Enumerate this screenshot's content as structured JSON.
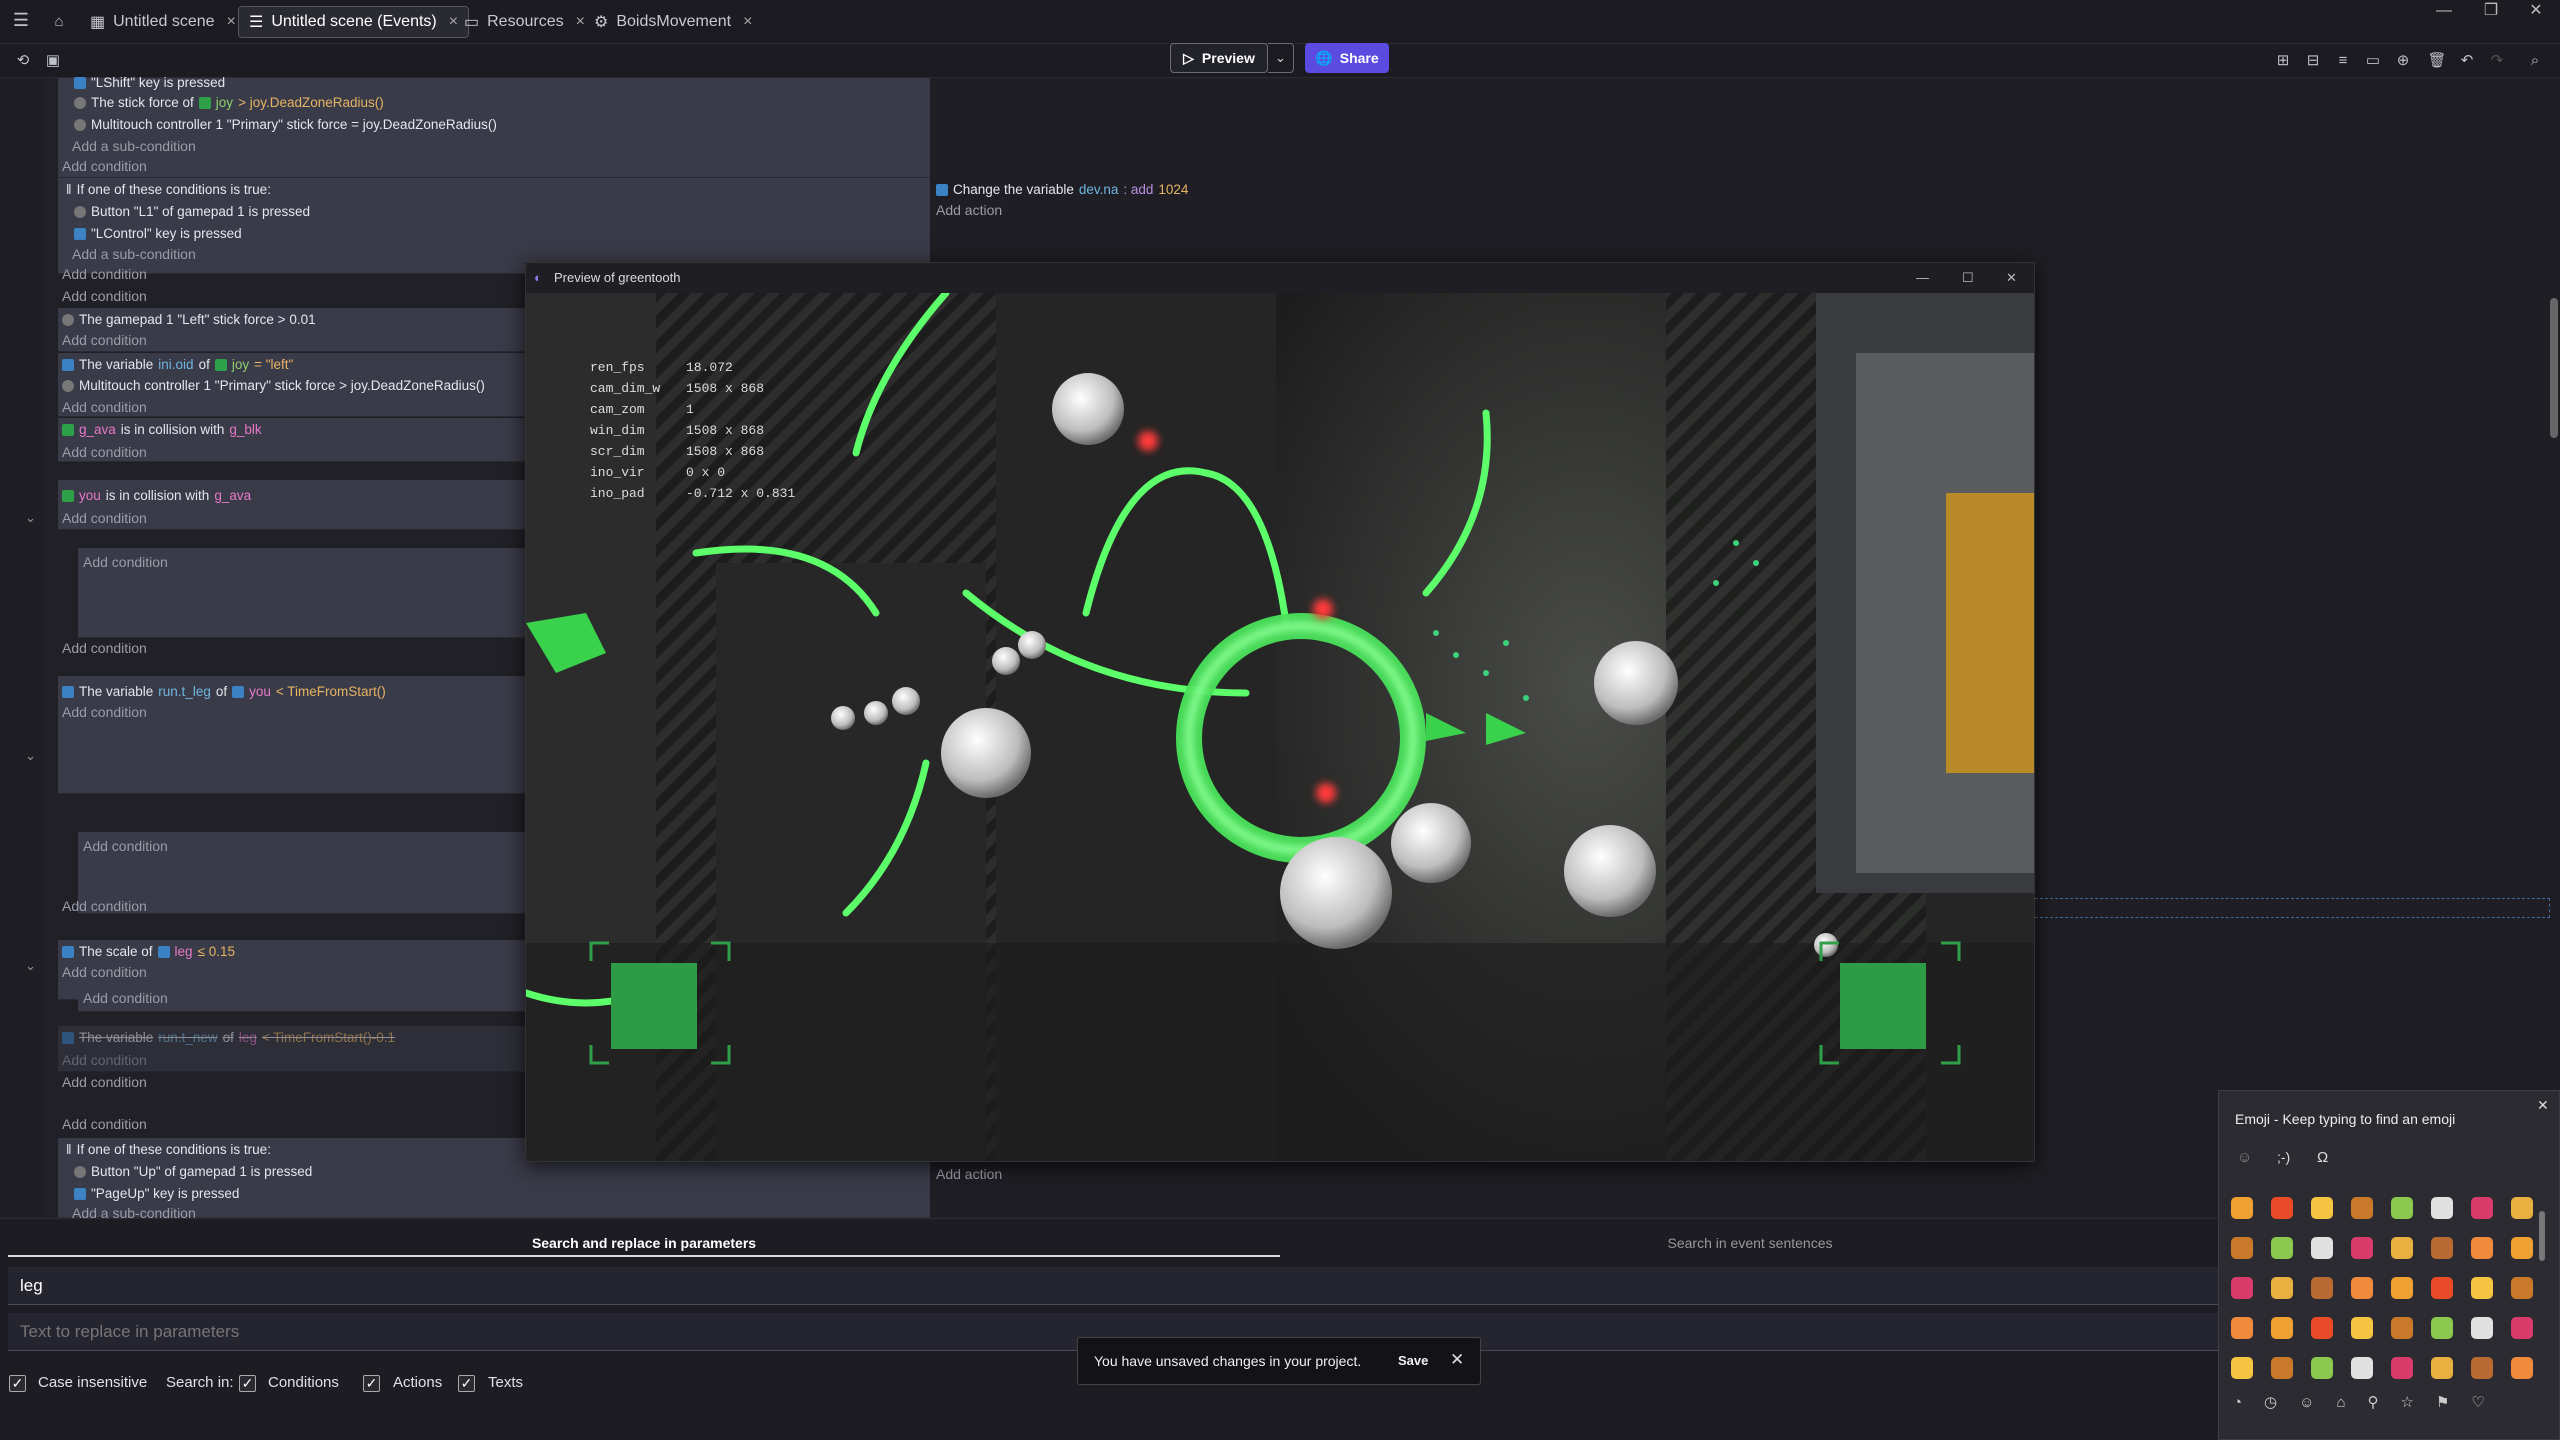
{
  "titlebar": {
    "tabs": [
      {
        "label": "Untitled scene",
        "icon": "scene-icon"
      },
      {
        "label": "Untitled scene (Events)",
        "icon": "events-icon"
      },
      {
        "label": "Resources",
        "icon": "resources-icon"
      },
      {
        "label": "BoidsMovement",
        "icon": "extension-icon"
      }
    ],
    "close_glyph": "×",
    "window_minimize": "—",
    "window_restore": "❐",
    "window_close": "✕"
  },
  "toolbar": {
    "preview_label": "Preview",
    "share_label": "Share"
  },
  "events": {
    "lines": [
      {
        "text": "\"LShift\" key is pressed"
      },
      {
        "text": "The stick force of",
        "obj": "joy",
        "rest": "> joy.DeadZoneRadius()"
      },
      {
        "text": "Multitouch controller 1 \"Primary\" stick force = joy.DeadZoneRadius()"
      },
      {
        "text": "Add a sub-condition"
      },
      {
        "text": "Add condition"
      },
      {
        "text": "If one of these conditions is true:"
      },
      {
        "text": "Button \"L1\" of gamepad 1 is pressed"
      },
      {
        "text": "\"LControl\" key is pressed"
      },
      {
        "text": "Add a sub-condition"
      },
      {
        "text": "Add condition"
      },
      {
        "text": "Add condition"
      },
      {
        "text": "The gamepad 1 \"Left\" stick force > 0.01"
      },
      {
        "text": "Add condition"
      },
      {
        "text": "The variable",
        "var": "ini.oid",
        "of": "of",
        "obj": "joy",
        "rest": "= \"left\""
      },
      {
        "text": "Multitouch controller 1 \"Primary\" stick force > joy.DeadZoneRadius()"
      },
      {
        "text": "Add condition"
      },
      {
        "text": "g_ava",
        "mid": "is in collision with",
        "obj": "g_blk"
      },
      {
        "text": "Add condition"
      },
      {
        "text": "you",
        "mid": "is in collision with",
        "obj": "g_ava"
      },
      {
        "text": "Add condition"
      },
      {
        "text": "Add condition"
      },
      {
        "text": "Add condition"
      },
      {
        "text": "The variable",
        "var": "run.t_leg",
        "of": "of",
        "obj": "you",
        "rest": "< TimeFromStart()"
      },
      {
        "text": "Add condition"
      },
      {
        "text": "Add condition"
      },
      {
        "text": "Add condition"
      },
      {
        "text": "The scale of",
        "obj": "leg",
        "rest": "≤ 0.15"
      },
      {
        "text": "Add condition"
      },
      {
        "text": "Add condition"
      },
      {
        "text": "The variable",
        "var": "run.t_new",
        "of": "of",
        "obj": "leg",
        "rest": "< TimeFromStart()-0.1"
      },
      {
        "text": "Add condition"
      },
      {
        "text": "Add condition"
      },
      {
        "text": "Add condition"
      },
      {
        "text": "If one of these conditions is true:"
      },
      {
        "text": "Button \"Up\" of gamepad 1 is pressed"
      },
      {
        "text": "\"PageUp\" key is pressed"
      },
      {
        "text": "Add a sub-condition"
      }
    ],
    "action_change": {
      "text": "Change the variable",
      "var": "dev.na",
      "op": ": add",
      "value": "1024"
    },
    "add_action": "Add action"
  },
  "preview_window": {
    "title": "Preview of greentooth",
    "debug": [
      [
        "ren_fps",
        "18.072"
      ],
      [
        "cam_dim_w",
        "1508 x 868"
      ],
      [
        "cam_zom",
        "1"
      ],
      [
        "win_dim",
        "1508 x 868"
      ],
      [
        "scr_dim",
        "1508 x 868"
      ],
      [
        "ino_vir",
        "0 x 0"
      ],
      [
        "ino_pad",
        "-0.712 x 0.831"
      ]
    ]
  },
  "find_panel": {
    "tab_params": "Search and replace in parameters",
    "tab_sentences": "Search in event sentences",
    "search_value": "leg",
    "replace_placeholder": "Text to replace in parameters",
    "case_label": "Case insensitive",
    "search_in_label": "Search in:",
    "conditions_label": "Conditions",
    "actions_label": "Actions",
    "texts_label": "Texts"
  },
  "toast": {
    "message": "You have unsaved changes in your project.",
    "save_label": "Save"
  },
  "emoji_panel": {
    "title": "Emoji - Keep typing to find an emoji",
    "tab_kaomoji": ";-)",
    "tab_symbols": "Ω"
  }
}
